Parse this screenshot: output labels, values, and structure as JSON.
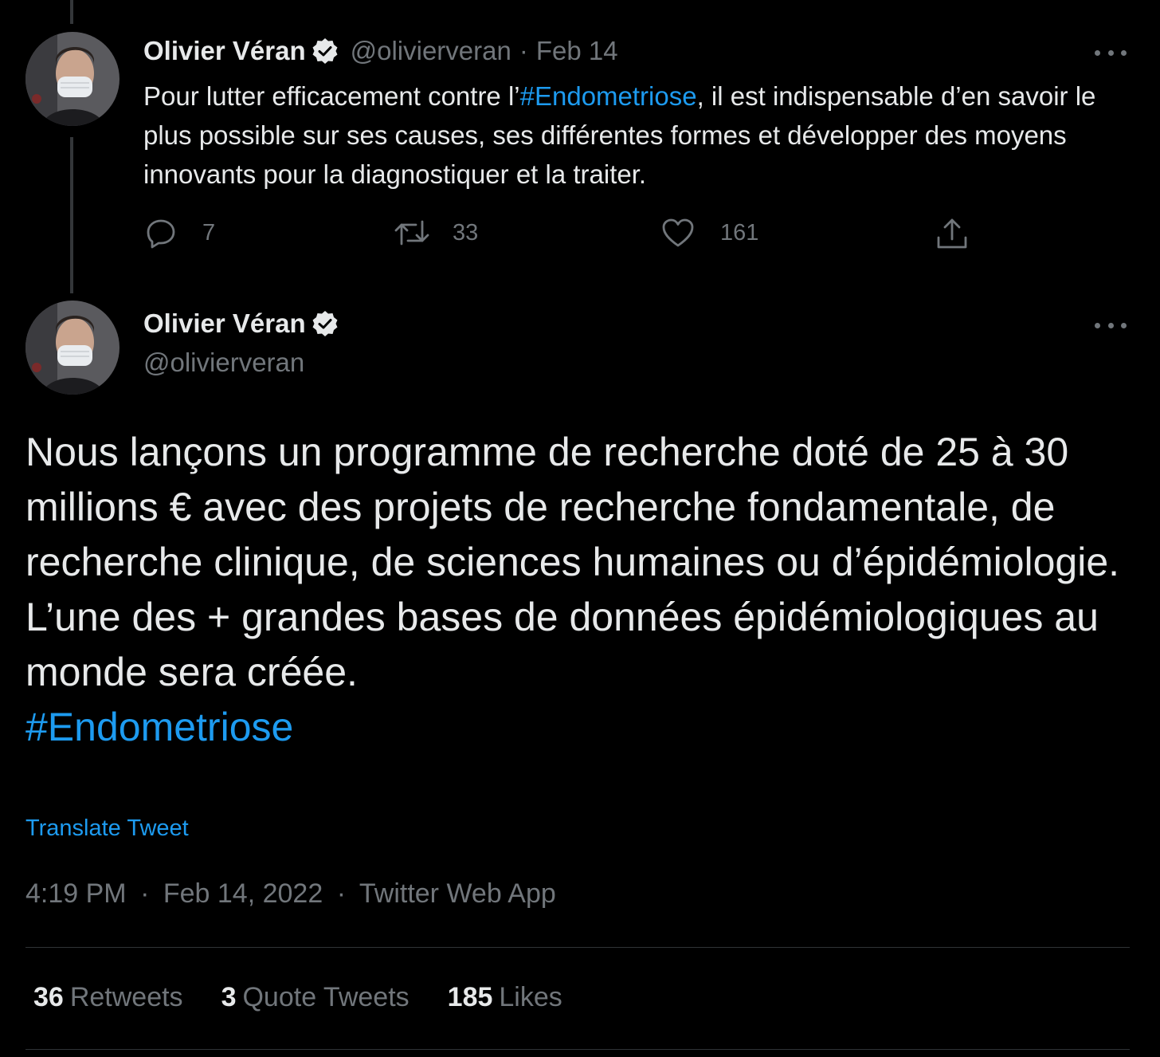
{
  "colors": {
    "background": "#000000",
    "text": "#e7e9ea",
    "muted": "#71767b",
    "link": "#1d9bf0"
  },
  "parent_tweet": {
    "author_name": "Olivier Véran",
    "handle": "@olivierveran",
    "separator": "·",
    "date": "Feb 14",
    "text_before": "Pour lutter efficacement contre l’",
    "hashtag": "#Endometriose",
    "text_after": ", il est indispensable d’en savoir le plus possible sur ses causes, ses différentes formes et développer des moyens innovants pour la diagnostiquer et la traiter.",
    "actions": {
      "reply_icon": "reply-icon",
      "reply_count": "7",
      "retweet_icon": "retweet-icon",
      "retweet_count": "33",
      "like_icon": "heart-icon",
      "like_count": "161",
      "share_icon": "share-icon"
    }
  },
  "main_tweet": {
    "author_name": "Olivier Véran",
    "handle": "@olivierveran",
    "lines": [
      "Nous lançons un programme de recherche doté de 25 à 30 millions € avec des projets de recherche fondamentale, de recherche clinique, de sciences humaines ou d’épidémiologie.",
      "L’une des + grandes bases de données épidémiologiques au monde sera créée."
    ],
    "hashtag": "#Endometriose",
    "translate_label": "Translate Tweet",
    "time": "4:19 PM",
    "date": "Feb 14, 2022",
    "source": "Twitter Web App",
    "separator": "·"
  },
  "stats": {
    "retweets_count": "36",
    "retweets_label": "Retweets",
    "quotes_count": "3",
    "quotes_label": "Quote Tweets",
    "likes_count": "185",
    "likes_label": "Likes"
  }
}
